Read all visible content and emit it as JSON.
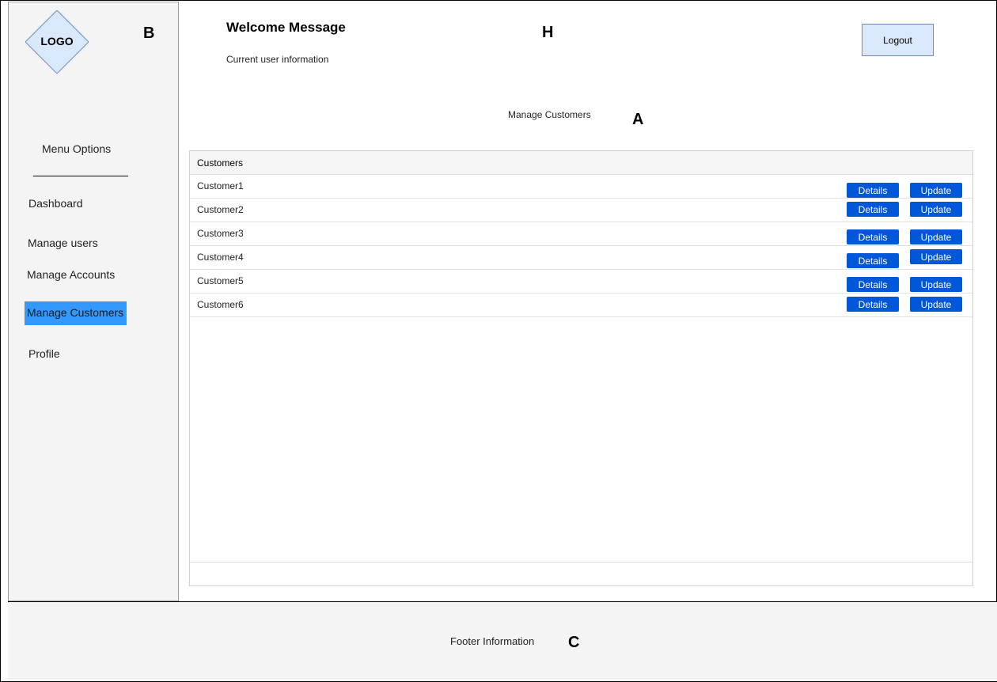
{
  "sidebar": {
    "logo": "LOGO",
    "region_label": "B",
    "menu_title": "Menu Options",
    "items": [
      {
        "label": "Dashboard"
      },
      {
        "label": "Manage users"
      },
      {
        "label": "Manage Accounts"
      },
      {
        "label": "Manage Customers",
        "active": true
      },
      {
        "label": "Profile"
      }
    ]
  },
  "header": {
    "welcome": "Welcome Message",
    "user_info": "Current user information",
    "region_label": "H",
    "logout_label": "Logout"
  },
  "main": {
    "title": "Manage Customers",
    "region_label": "A",
    "table": {
      "header": "Customers",
      "rows": [
        {
          "name": "Customer1",
          "details": "Details",
          "update": "Update"
        },
        {
          "name": "Customer2",
          "details": "Details",
          "update": "Update"
        },
        {
          "name": "Customer3",
          "details": "Details",
          "update": "Update"
        },
        {
          "name": "Customer4",
          "details": "Details",
          "update": "Update"
        },
        {
          "name": "Customer5",
          "details": "Details",
          "update": "Update"
        },
        {
          "name": "Customer6",
          "details": "Details",
          "update": "Update"
        }
      ]
    }
  },
  "footer": {
    "text": "Footer Information",
    "region_label": "C"
  },
  "colors": {
    "active_menu": "#3399ff",
    "button": "#0057d8",
    "logout_bg": "#dae8fc",
    "panel_bg": "#f4f4f4"
  }
}
